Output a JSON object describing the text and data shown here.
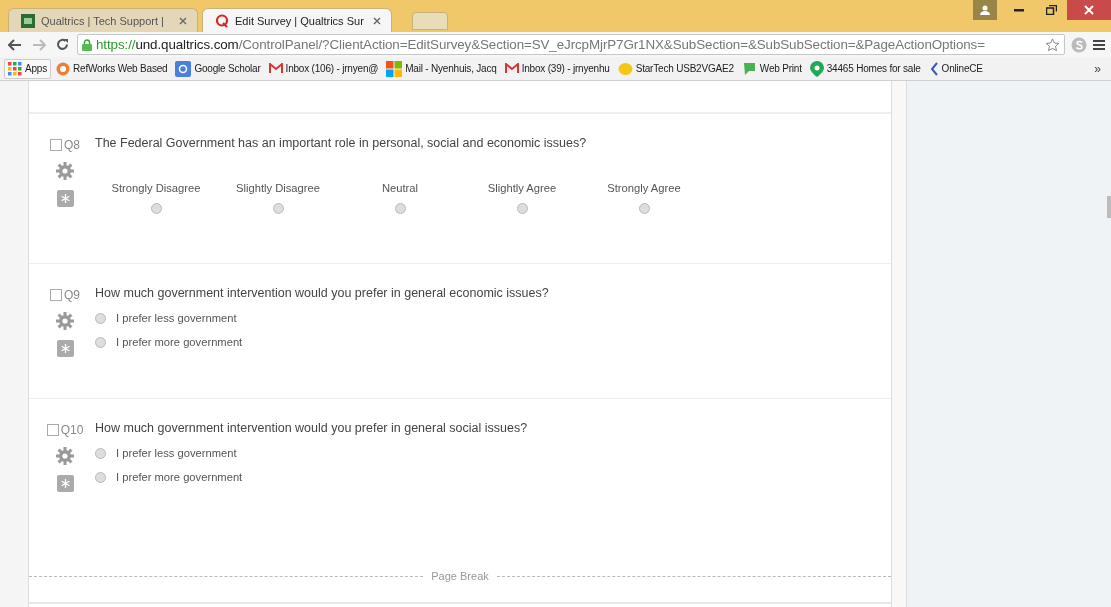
{
  "browser": {
    "tabs": [
      {
        "title": "Qualtrics | Tech Support |",
        "selected": false
      },
      {
        "title": "Edit Survey | Qualtrics Sur",
        "selected": true
      }
    ],
    "url": {
      "scheme": "https://",
      "host": "und.qualtrics.com",
      "path": "/ControlPanel/?ClientAction=EditSurvey&Section=SV_eJrcpMjrP7Gr1NX&SubSection=&SubSubSection=&PageActionOptions="
    },
    "bookmarks": [
      "Apps",
      "RefWorks Web Based",
      "Google Scholar",
      "Inbox (106) - jrnyen@",
      "Mail - Nyenhuis, Jacq",
      "Inbox (39) - jrnyenhu",
      "StarTech USB2VGAE2",
      "Web Print",
      "34465 Homes for sale",
      "OnlineCE"
    ],
    "more_bookmarks": "»"
  },
  "questions": [
    {
      "kind": "scale",
      "number": "Q8",
      "checked": false,
      "text": "The Federal Government has an important role in personal, social and economic issues?",
      "options": [
        {
          "label": "Strongly Disagree",
          "selected": false
        },
        {
          "label": "Slightly Disagree",
          "selected": false
        },
        {
          "label": "Neutral",
          "selected": false
        },
        {
          "label": "Slightly Agree",
          "selected": false
        },
        {
          "label": "Strongly Agree",
          "selected": false
        }
      ]
    },
    {
      "kind": "choice",
      "number": "Q9",
      "checked": false,
      "text": "How much government intervention would you prefer in general economic issues?",
      "options": [
        {
          "label": "I prefer less government",
          "selected": false
        },
        {
          "label": "I prefer more government",
          "selected": false
        }
      ]
    },
    {
      "kind": "choice",
      "number": "Q10",
      "checked": false,
      "text": "How much government intervention would you prefer in general social issues?",
      "options": [
        {
          "label": "I prefer less government",
          "selected": false
        },
        {
          "label": "I prefer more government",
          "selected": false
        }
      ]
    }
  ],
  "page_break": "Page Break"
}
